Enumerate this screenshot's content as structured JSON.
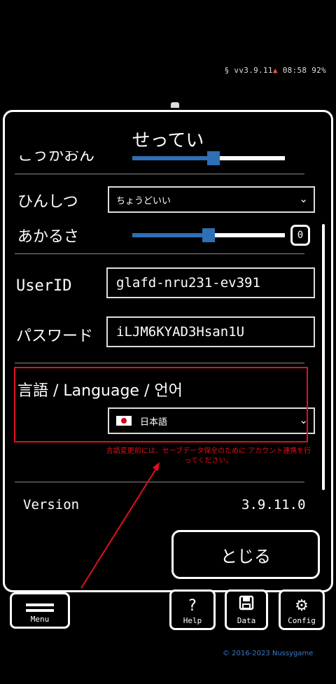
{
  "status_bar": {
    "text_main": "§ vv3.9.11",
    "text_warn": "▲",
    "text_time": "08:58 92%"
  },
  "dialog": {
    "title": "せってい",
    "partial_top_label": "こうかおん",
    "quality": {
      "label": "ひんしつ",
      "value": "ちょうどいい"
    },
    "brightness": {
      "label": "あかるさ",
      "value": "0",
      "level": 0.5
    },
    "top_slider_level": 0.53,
    "userid": {
      "label": "UserID",
      "value": "glafd-nru231-ev391"
    },
    "password": {
      "label": "パスワード",
      "value": "iLJM6KYAD3Hsan1U"
    },
    "language": {
      "label": "言語 / Language / 언어",
      "value": "日本語"
    },
    "language_note": "言語変更前には、セーブデータ保全のために アカウント連携を行ってください。",
    "version": {
      "label": "Version",
      "value": "3.9.11.0"
    },
    "close_label": "とじる"
  },
  "bottom_bar": {
    "menu": "Menu",
    "help": "Help",
    "help_icon": "?",
    "data": "Data",
    "config": "Config"
  },
  "copyright": "© 2016-2023 Nussygame",
  "colors": {
    "accent": "#2e6fb5",
    "highlight": "#e01020",
    "note": "#e0101a"
  }
}
